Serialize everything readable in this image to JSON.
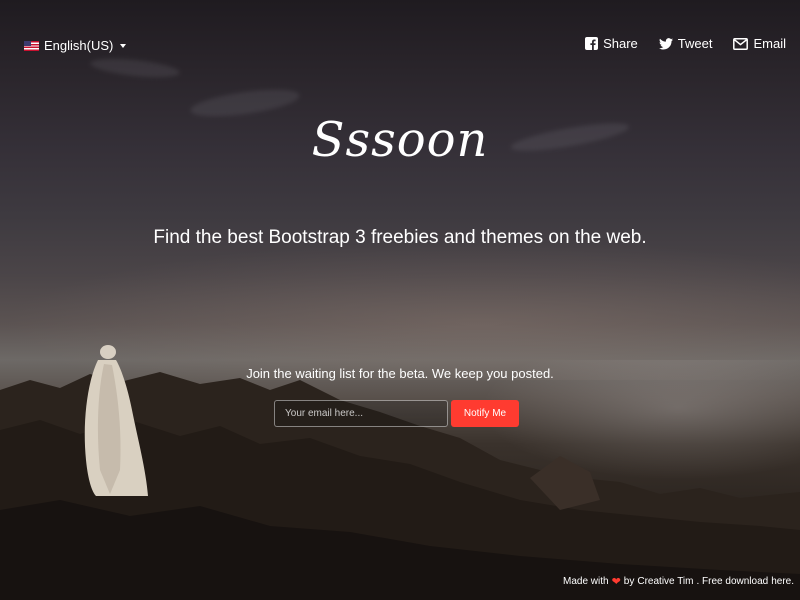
{
  "language": {
    "label": "English(US)",
    "flag_icon": "us-flag-icon"
  },
  "social": [
    {
      "label": "Share",
      "icon": "facebook-icon"
    },
    {
      "label": "Tweet",
      "icon": "twitter-icon"
    },
    {
      "label": "Email",
      "icon": "envelope-icon"
    }
  ],
  "hero": {
    "logo": "Sssoon",
    "tagline": "Find the best Bootstrap 3 freebies and themes on the web."
  },
  "subscribe": {
    "text": "Join the waiting list for the beta. We keep you posted.",
    "email_placeholder": "Your email here...",
    "email_value": "",
    "button_label": "Notify Me"
  },
  "footer": {
    "made_with": "Made with",
    "by": "by",
    "author": "Creative Tim",
    "free_download": ". Free download",
    "here": "here."
  },
  "colors": {
    "accent": "#ff3b30",
    "text": "#ffffff"
  }
}
